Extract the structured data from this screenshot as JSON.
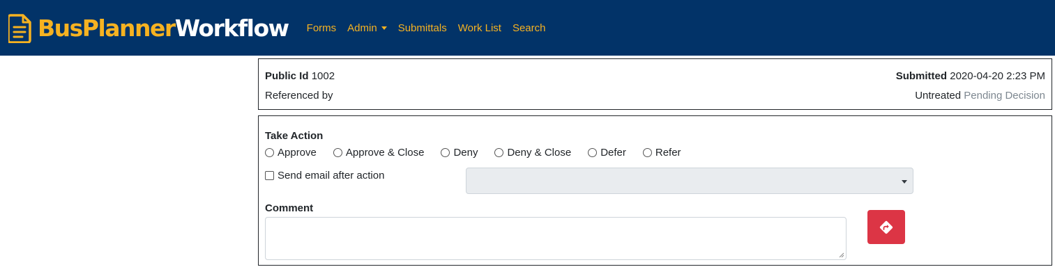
{
  "brand": {
    "part1": "BusPlanner",
    "part2": "Workflow"
  },
  "nav": {
    "forms": "Forms",
    "admin": "Admin",
    "submittals": "Submittals",
    "work_list": "Work List",
    "search": "Search"
  },
  "info": {
    "public_id_label": "Public Id",
    "public_id_value": "1002",
    "referenced_by_label": "Referenced by",
    "submitted_label": "Submitted",
    "submitted_value": "2020-04-20 2:23 PM",
    "status": "Untreated",
    "status_detail": "Pending Decision"
  },
  "action": {
    "title": "Take Action",
    "options": [
      "Approve",
      "Approve & Close",
      "Deny",
      "Deny & Close",
      "Defer",
      "Refer"
    ],
    "send_email_label": "Send email after action",
    "send_email_checked": false,
    "select_value": "",
    "comment_label": "Comment",
    "comment_value": ""
  },
  "colors": {
    "navbar_bg": "#023368",
    "accent": "#f6b221",
    "submit_button": "#dc3545"
  },
  "icons": {
    "brand": "document-icon",
    "submit": "share-arrow-icon"
  }
}
